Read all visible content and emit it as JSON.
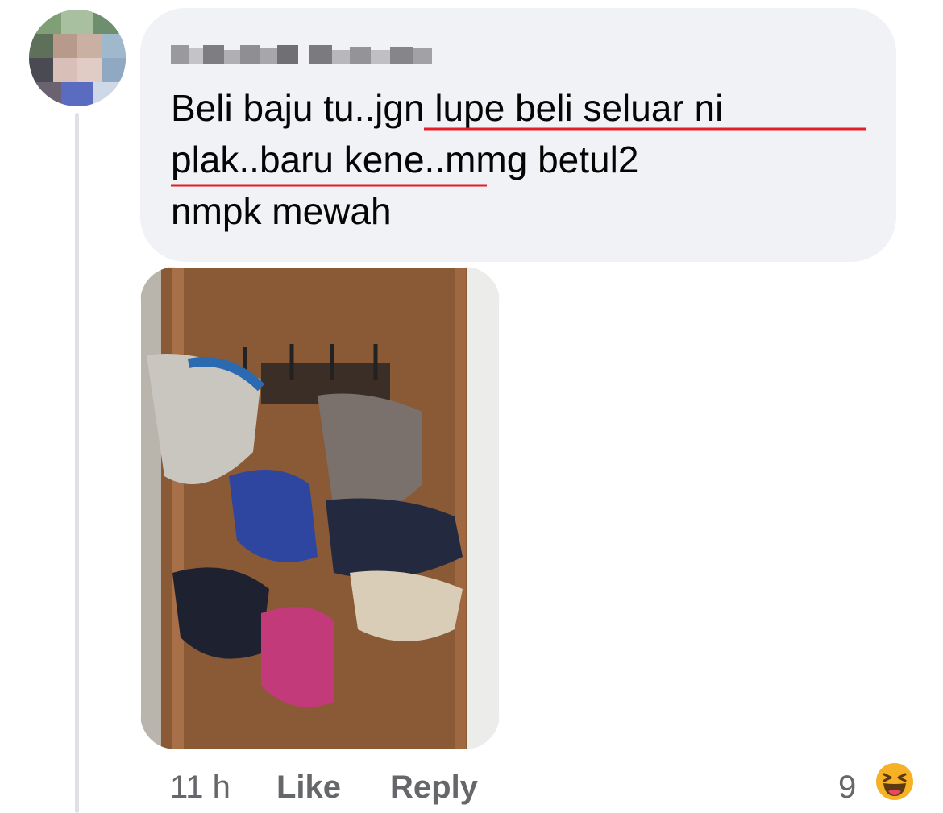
{
  "comment": {
    "author": "",
    "text_lines": [
      "Beli baju tu..jgn lupe beli seluar ni",
      "plak..baru kene..mmg betul2",
      "nmpk mewah"
    ],
    "time": "11 h",
    "like_label": "Like",
    "reply_label": "Reply",
    "reaction_count": "9",
    "reaction_type": "haha-emoji-icon"
  },
  "colors": {
    "bubble": "#f0f2f5",
    "text": "#050505",
    "meta": "#65676b",
    "spellcheck_underline": "#e41e26"
  }
}
